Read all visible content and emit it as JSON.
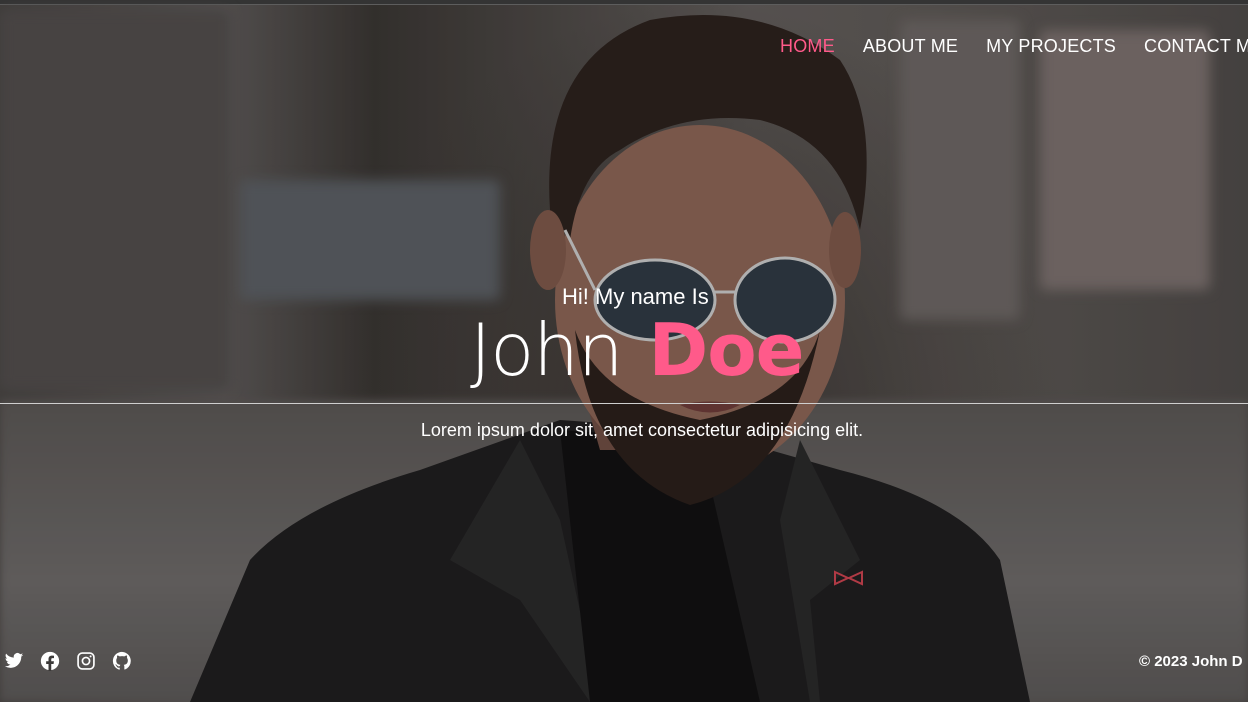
{
  "nav": {
    "items": [
      {
        "label": "HOME",
        "active": true
      },
      {
        "label": "ABOUT ME",
        "active": false
      },
      {
        "label": "MY PROJECTS",
        "active": false
      },
      {
        "label": "CONTACT ME",
        "active": false
      }
    ]
  },
  "hero": {
    "greeting": "Hi! My name Is",
    "first_name": "John",
    "last_name": "Doe",
    "tagline": "Lorem ipsum dolor sit, amet consectetur adipisicing elit."
  },
  "footer": {
    "social_icons": [
      "twitter-icon",
      "facebook-icon",
      "instagram-icon",
      "github-icon"
    ],
    "copyright": "© 2023 John D"
  },
  "colors": {
    "accent": "#ff5a8a",
    "text": "#ffffff"
  }
}
